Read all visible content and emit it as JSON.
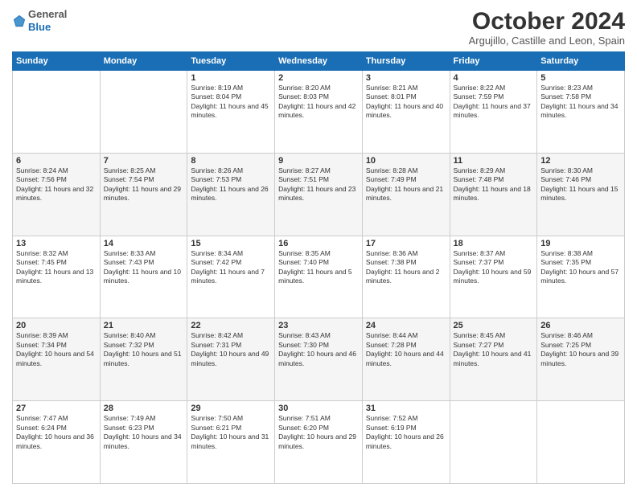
{
  "header": {
    "logo_general": "General",
    "logo_blue": "Blue",
    "month": "October 2024",
    "location": "Argujillo, Castille and Leon, Spain"
  },
  "days_of_week": [
    "Sunday",
    "Monday",
    "Tuesday",
    "Wednesday",
    "Thursday",
    "Friday",
    "Saturday"
  ],
  "weeks": [
    [
      {
        "day": "",
        "content": ""
      },
      {
        "day": "",
        "content": ""
      },
      {
        "day": "1",
        "content": "Sunrise: 8:19 AM\nSunset: 8:04 PM\nDaylight: 11 hours and 45 minutes."
      },
      {
        "day": "2",
        "content": "Sunrise: 8:20 AM\nSunset: 8:03 PM\nDaylight: 11 hours and 42 minutes."
      },
      {
        "day": "3",
        "content": "Sunrise: 8:21 AM\nSunset: 8:01 PM\nDaylight: 11 hours and 40 minutes."
      },
      {
        "day": "4",
        "content": "Sunrise: 8:22 AM\nSunset: 7:59 PM\nDaylight: 11 hours and 37 minutes."
      },
      {
        "day": "5",
        "content": "Sunrise: 8:23 AM\nSunset: 7:58 PM\nDaylight: 11 hours and 34 minutes."
      }
    ],
    [
      {
        "day": "6",
        "content": "Sunrise: 8:24 AM\nSunset: 7:56 PM\nDaylight: 11 hours and 32 minutes."
      },
      {
        "day": "7",
        "content": "Sunrise: 8:25 AM\nSunset: 7:54 PM\nDaylight: 11 hours and 29 minutes."
      },
      {
        "day": "8",
        "content": "Sunrise: 8:26 AM\nSunset: 7:53 PM\nDaylight: 11 hours and 26 minutes."
      },
      {
        "day": "9",
        "content": "Sunrise: 8:27 AM\nSunset: 7:51 PM\nDaylight: 11 hours and 23 minutes."
      },
      {
        "day": "10",
        "content": "Sunrise: 8:28 AM\nSunset: 7:49 PM\nDaylight: 11 hours and 21 minutes."
      },
      {
        "day": "11",
        "content": "Sunrise: 8:29 AM\nSunset: 7:48 PM\nDaylight: 11 hours and 18 minutes."
      },
      {
        "day": "12",
        "content": "Sunrise: 8:30 AM\nSunset: 7:46 PM\nDaylight: 11 hours and 15 minutes."
      }
    ],
    [
      {
        "day": "13",
        "content": "Sunrise: 8:32 AM\nSunset: 7:45 PM\nDaylight: 11 hours and 13 minutes."
      },
      {
        "day": "14",
        "content": "Sunrise: 8:33 AM\nSunset: 7:43 PM\nDaylight: 11 hours and 10 minutes."
      },
      {
        "day": "15",
        "content": "Sunrise: 8:34 AM\nSunset: 7:42 PM\nDaylight: 11 hours and 7 minutes."
      },
      {
        "day": "16",
        "content": "Sunrise: 8:35 AM\nSunset: 7:40 PM\nDaylight: 11 hours and 5 minutes."
      },
      {
        "day": "17",
        "content": "Sunrise: 8:36 AM\nSunset: 7:38 PM\nDaylight: 11 hours and 2 minutes."
      },
      {
        "day": "18",
        "content": "Sunrise: 8:37 AM\nSunset: 7:37 PM\nDaylight: 10 hours and 59 minutes."
      },
      {
        "day": "19",
        "content": "Sunrise: 8:38 AM\nSunset: 7:35 PM\nDaylight: 10 hours and 57 minutes."
      }
    ],
    [
      {
        "day": "20",
        "content": "Sunrise: 8:39 AM\nSunset: 7:34 PM\nDaylight: 10 hours and 54 minutes."
      },
      {
        "day": "21",
        "content": "Sunrise: 8:40 AM\nSunset: 7:32 PM\nDaylight: 10 hours and 51 minutes."
      },
      {
        "day": "22",
        "content": "Sunrise: 8:42 AM\nSunset: 7:31 PM\nDaylight: 10 hours and 49 minutes."
      },
      {
        "day": "23",
        "content": "Sunrise: 8:43 AM\nSunset: 7:30 PM\nDaylight: 10 hours and 46 minutes."
      },
      {
        "day": "24",
        "content": "Sunrise: 8:44 AM\nSunset: 7:28 PM\nDaylight: 10 hours and 44 minutes."
      },
      {
        "day": "25",
        "content": "Sunrise: 8:45 AM\nSunset: 7:27 PM\nDaylight: 10 hours and 41 minutes."
      },
      {
        "day": "26",
        "content": "Sunrise: 8:46 AM\nSunset: 7:25 PM\nDaylight: 10 hours and 39 minutes."
      }
    ],
    [
      {
        "day": "27",
        "content": "Sunrise: 7:47 AM\nSunset: 6:24 PM\nDaylight: 10 hours and 36 minutes."
      },
      {
        "day": "28",
        "content": "Sunrise: 7:49 AM\nSunset: 6:23 PM\nDaylight: 10 hours and 34 minutes."
      },
      {
        "day": "29",
        "content": "Sunrise: 7:50 AM\nSunset: 6:21 PM\nDaylight: 10 hours and 31 minutes."
      },
      {
        "day": "30",
        "content": "Sunrise: 7:51 AM\nSunset: 6:20 PM\nDaylight: 10 hours and 29 minutes."
      },
      {
        "day": "31",
        "content": "Sunrise: 7:52 AM\nSunset: 6:19 PM\nDaylight: 10 hours and 26 minutes."
      },
      {
        "day": "",
        "content": ""
      },
      {
        "day": "",
        "content": ""
      }
    ]
  ]
}
